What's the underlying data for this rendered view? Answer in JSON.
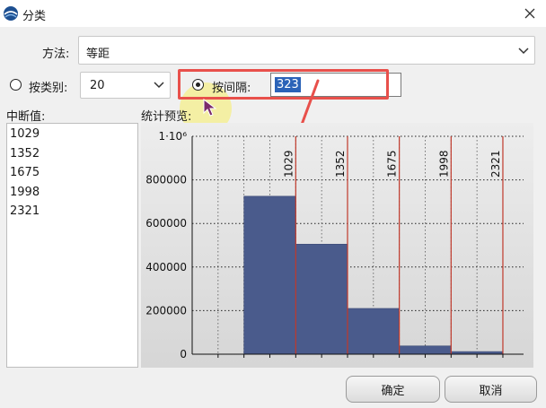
{
  "window": {
    "title": "分类"
  },
  "method": {
    "label": "方法:",
    "value": "等距"
  },
  "by_class": {
    "label": "按类别:",
    "value": "20"
  },
  "by_interval": {
    "label": "按间隔:",
    "value": "323"
  },
  "breaks": {
    "label": "中断值:",
    "items": [
      "1029",
      "1352",
      "1675",
      "1998",
      "2321"
    ]
  },
  "preview": {
    "label": "统计预览:"
  },
  "buttons": {
    "ok": "确定",
    "cancel": "取消"
  },
  "colors": {
    "bar": "#4a5b8c",
    "break_line": "#c0392b",
    "highlight": "#e8504b",
    "selection": "#2b63b8"
  },
  "chart_data": {
    "type": "bar",
    "y_ticks": [
      "0",
      "200000",
      "400000",
      "600000",
      "800000",
      "1·10⁶"
    ],
    "y_tick_values": [
      0,
      200000,
      400000,
      600000,
      800000,
      1000000
    ],
    "ylim": [
      0,
      1000000
    ],
    "xlim": [
      383,
      2450
    ],
    "bins": [
      {
        "from": 706,
        "to": 1029,
        "value": 725000
      },
      {
        "from": 1029,
        "to": 1352,
        "value": 505000
      },
      {
        "from": 1352,
        "to": 1675,
        "value": 210000
      },
      {
        "from": 1675,
        "to": 1998,
        "value": 38000
      },
      {
        "from": 1998,
        "to": 2321,
        "value": 12000
      }
    ],
    "break_values": [
      1029,
      1352,
      1675,
      1998,
      2321
    ],
    "break_labels": [
      "1029",
      "1352",
      "1675",
      "1998",
      "2321"
    ],
    "grid": true
  }
}
